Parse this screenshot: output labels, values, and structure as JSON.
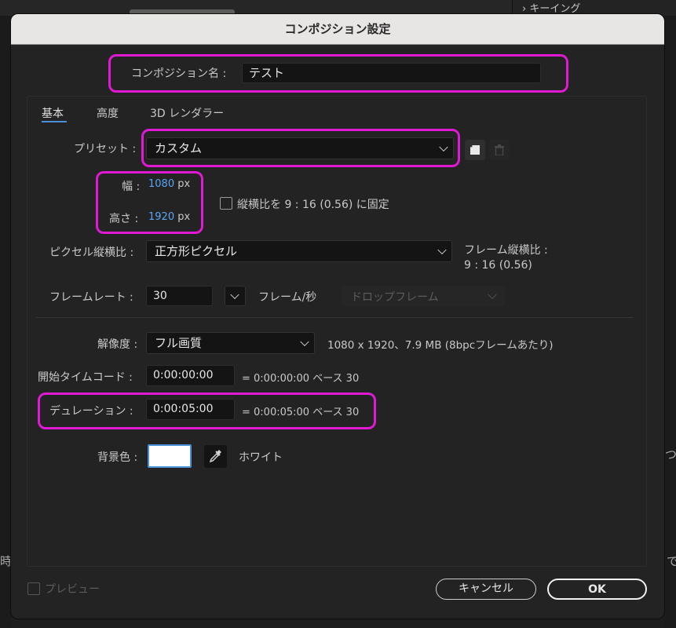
{
  "background": {
    "keying_label": "キーイング",
    "left_char": "時",
    "right_char_1": "つ",
    "right_char_2": "で"
  },
  "dialog": {
    "title": "コンポジション設定",
    "comp_name_label": "コンポジション名 :",
    "comp_name_value": "テスト",
    "tabs": [
      {
        "label": "基本",
        "active": true
      },
      {
        "label": "高度",
        "active": false
      },
      {
        "label": "3D レンダラー",
        "active": false
      }
    ],
    "preset": {
      "label": "プリセット :",
      "value": "カスタム"
    },
    "width": {
      "label": "幅 :",
      "value": "1080",
      "unit": "px"
    },
    "height": {
      "label": "高さ :",
      "value": "1920",
      "unit": "px"
    },
    "lock_aspect": {
      "label": "縦横比を 9 : 16 (0.56) に固定",
      "checked": false
    },
    "pixel_aspect": {
      "label": "ピクセル縦横比 :",
      "value": "正方形ピクセル",
      "frame_aspect_label": "フレーム縦横比 :",
      "frame_aspect_value": "9 : 16 (0.56)"
    },
    "frame_rate": {
      "label": "フレームレート :",
      "value": "30",
      "unit": "フレーム/秒",
      "drop_frame": "ドロップフレーム"
    },
    "resolution": {
      "label": "解像度 :",
      "value": "フル画質",
      "info": "1080 x 1920、7.9 MB (8bpcフレームあたり)"
    },
    "start_timecode": {
      "label": "開始タイムコード :",
      "value": "0:00:00:00",
      "info": "= 0:00:00:00  ベース 30"
    },
    "duration": {
      "label": "デュレーション :",
      "value": "0:00:05:00",
      "info": "= 0:00:05:00  ベース 30"
    },
    "bg_color": {
      "label": "背景色 :",
      "color": "#ffffff",
      "name": "ホワイト"
    },
    "preview": {
      "label": "プレビュー",
      "checked": false
    },
    "cancel_label": "キャンセル",
    "ok_label": "OK"
  },
  "colors": {
    "highlight": "#e019d3",
    "value_blue": "#5aa6f2"
  }
}
